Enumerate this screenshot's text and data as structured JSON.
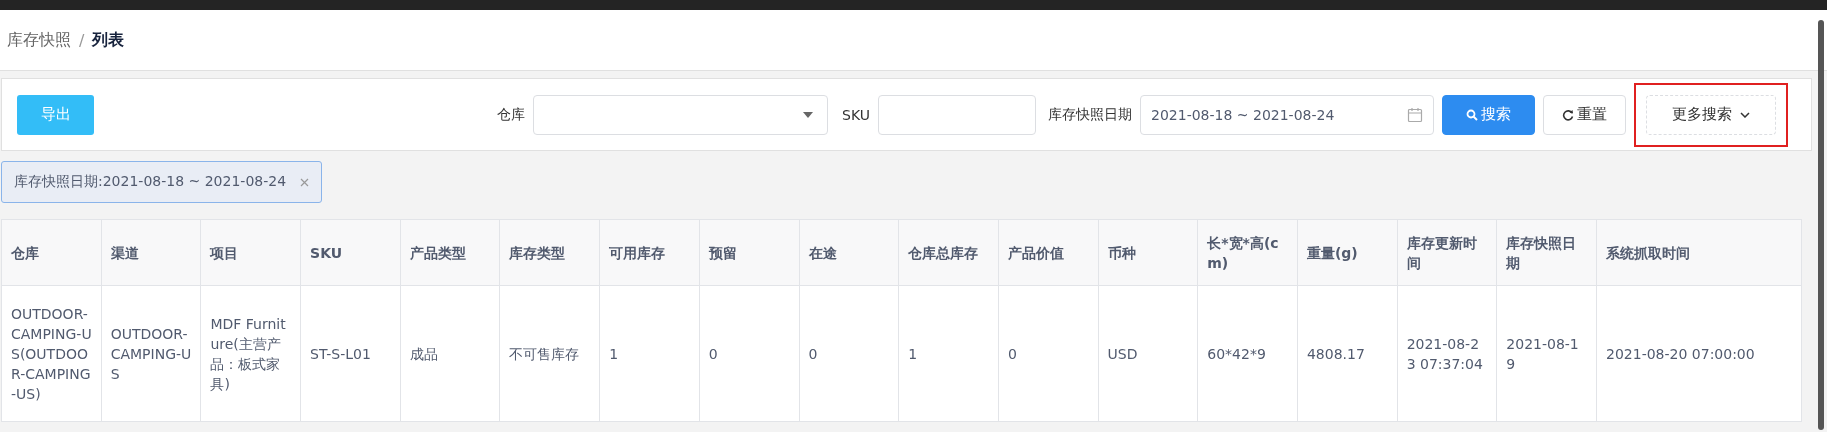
{
  "breadcrumb": {
    "separator": "/",
    "items": [
      {
        "label": "库存快照",
        "current": false
      },
      {
        "label": "列表",
        "current": true
      }
    ]
  },
  "toolbar": {
    "export_button": "导出",
    "filters": [
      {
        "kind": "select",
        "label": "仓库"
      },
      {
        "kind": "input",
        "label": "SKU"
      },
      {
        "kind": "date",
        "label": "库存快照日期",
        "value": "2021-08-18 ~ 2021-08-24"
      }
    ],
    "buttons": [
      {
        "kind": "search",
        "label": "搜索"
      },
      {
        "kind": "reset",
        "label": "重置"
      },
      {
        "kind": "more",
        "label": "更多搜索",
        "highlighted": true
      }
    ]
  },
  "active_filters": [
    {
      "label": "库存快照日期:2021-08-18 ~ 2021-08-24"
    }
  ],
  "table": {
    "columns": [
      "仓库",
      "渠道",
      "项目",
      "SKU",
      "产品类型",
      "库存类型",
      "可用库存",
      "预留",
      "在途",
      "仓库总库存",
      "产品价值",
      "币种",
      "长*宽*高(cm)",
      "重量(g)",
      "库存更新时间",
      "库存快照日期",
      "系统抓取时间"
    ],
    "rows": [
      [
        "OUTDOOR-CAMPING-US(OUTDOOR-CAMPING-US)",
        "OUTDOOR-CAMPING-US",
        "MDF Furniture(主营产品：板式家具)",
        "ST-S-L01",
        "成品",
        "不可售库存",
        "1",
        "0",
        "0",
        "1",
        "0",
        "USD",
        "60*42*9",
        "4808.17",
        "2021-08-23 07:37:04",
        "2021-08-19",
        "2021-08-20 07:00:00"
      ]
    ]
  }
}
